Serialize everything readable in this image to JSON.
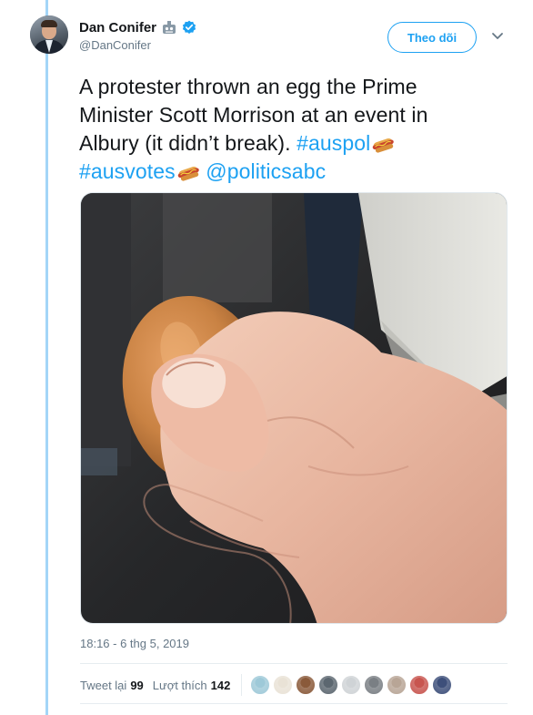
{
  "author": {
    "display_name": "Dan Conifer",
    "handle": "@DanConifer",
    "avatar_icon": "profile-photo",
    "badge_icons": [
      "bot-icon",
      "verified-icon"
    ]
  },
  "follow_label": "Theo dõi",
  "more_icon": "chevron-down-icon",
  "tweet": {
    "line1": "A protester thrown an egg the Prime",
    "line2": "Minister Scott Morrison at an event in",
    "line3_text": "Albury (it didn’t break). ",
    "hashtag_auspol": "#auspol",
    "hashtag_ausvotes": "#ausvotes",
    "mention": "@politicsabc",
    "emoji": "hot-dog-emoji"
  },
  "media": {
    "description_icon": "photo"
  },
  "timestamp": "18:16 - 6 thg 5, 2019",
  "stats": {
    "retweets_label": "Tweet lại",
    "retweets_count": "99",
    "likes_label": "Lượt thích",
    "likes_count": "142"
  },
  "likers": [
    {
      "color": "#9ec9d8"
    },
    {
      "color": "#e9e2d6"
    },
    {
      "color": "#8a5a3a"
    },
    {
      "color": "#5c6770"
    },
    {
      "color": "#cfd3d6"
    },
    {
      "color": "#7a7f84"
    },
    {
      "color": "#b8a596"
    },
    {
      "color": "#c8554f"
    },
    {
      "color": "#3d4f7a"
    }
  ],
  "colors": {
    "accent": "#1da1f2",
    "thread_line": "#a3d5f7",
    "muted": "#657786"
  }
}
